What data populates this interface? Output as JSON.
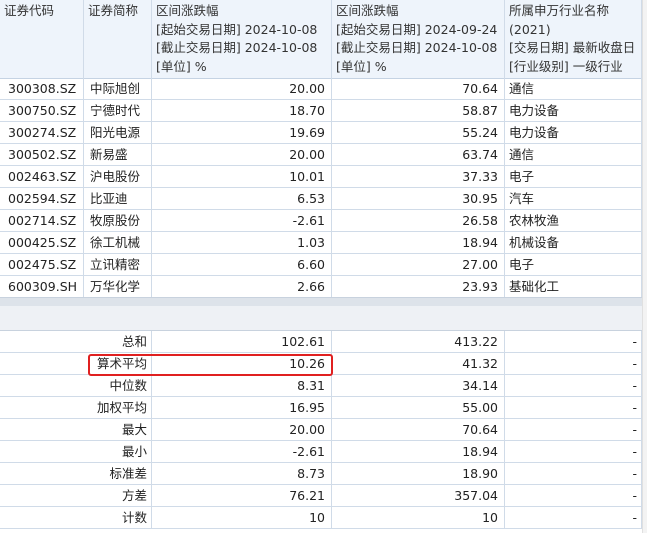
{
  "header": {
    "col0": "证券代码",
    "col1": "证券简称",
    "col2": [
      "区间涨跌幅",
      "[起始交易日期] 2024-10-08",
      "[截止交易日期] 2024-10-08",
      "[单位] %"
    ],
    "col3": [
      "区间涨跌幅",
      "[起始交易日期] 2024-09-24",
      "[截止交易日期] 2024-10-08",
      "[单位] %"
    ],
    "col4": [
      "所属申万行业名称",
      "(2021)",
      "[交易日期] 最新收盘日",
      "[行业级别] 一级行业"
    ]
  },
  "rows": [
    {
      "code": "300308.SZ",
      "name": "中际旭创",
      "chg1": "20.00",
      "chg2": "70.64",
      "industry": "通信"
    },
    {
      "code": "300750.SZ",
      "name": "宁德时代",
      "chg1": "18.70",
      "chg2": "58.87",
      "industry": "电力设备"
    },
    {
      "code": "300274.SZ",
      "name": "阳光电源",
      "chg1": "19.69",
      "chg2": "55.24",
      "industry": "电力设备"
    },
    {
      "code": "300502.SZ",
      "name": "新易盛",
      "chg1": "20.00",
      "chg2": "63.74",
      "industry": "通信"
    },
    {
      "code": "002463.SZ",
      "name": "沪电股份",
      "chg1": "10.01",
      "chg2": "37.33",
      "industry": "电子"
    },
    {
      "code": "002594.SZ",
      "name": "比亚迪",
      "chg1": "6.53",
      "chg2": "30.95",
      "industry": "汽车"
    },
    {
      "code": "002714.SZ",
      "name": "牧原股份",
      "chg1": "-2.61",
      "chg2": "26.58",
      "industry": "农林牧渔"
    },
    {
      "code": "000425.SZ",
      "name": "徐工机械",
      "chg1": "1.03",
      "chg2": "18.94",
      "industry": "机械设备"
    },
    {
      "code": "002475.SZ",
      "name": "立讯精密",
      "chg1": "6.60",
      "chg2": "27.00",
      "industry": "电子"
    },
    {
      "code": "600309.SH",
      "name": "万华化学",
      "chg1": "2.66",
      "chg2": "23.93",
      "industry": "基础化工"
    }
  ],
  "summary": [
    {
      "label": "总和",
      "v1": "102.61",
      "v2": "413.22",
      "v3": "-"
    },
    {
      "label": "算术平均",
      "v1": "10.26",
      "v2": "41.32",
      "v3": "-"
    },
    {
      "label": "中位数",
      "v1": "8.31",
      "v2": "34.14",
      "v3": "-"
    },
    {
      "label": "加权平均",
      "v1": "16.95",
      "v2": "55.00",
      "v3": "-"
    },
    {
      "label": "最大",
      "v1": "20.00",
      "v2": "70.64",
      "v3": "-"
    },
    {
      "label": "最小",
      "v1": "-2.61",
      "v2": "18.94",
      "v3": "-"
    },
    {
      "label": "标准差",
      "v1": "8.73",
      "v2": "18.90",
      "v3": "-"
    },
    {
      "label": "方差",
      "v1": "76.21",
      "v2": "357.04",
      "v3": "-"
    },
    {
      "label": "计数",
      "v1": "10",
      "v2": "10",
      "v3": "-"
    }
  ],
  "highlight_color": "#e02020"
}
